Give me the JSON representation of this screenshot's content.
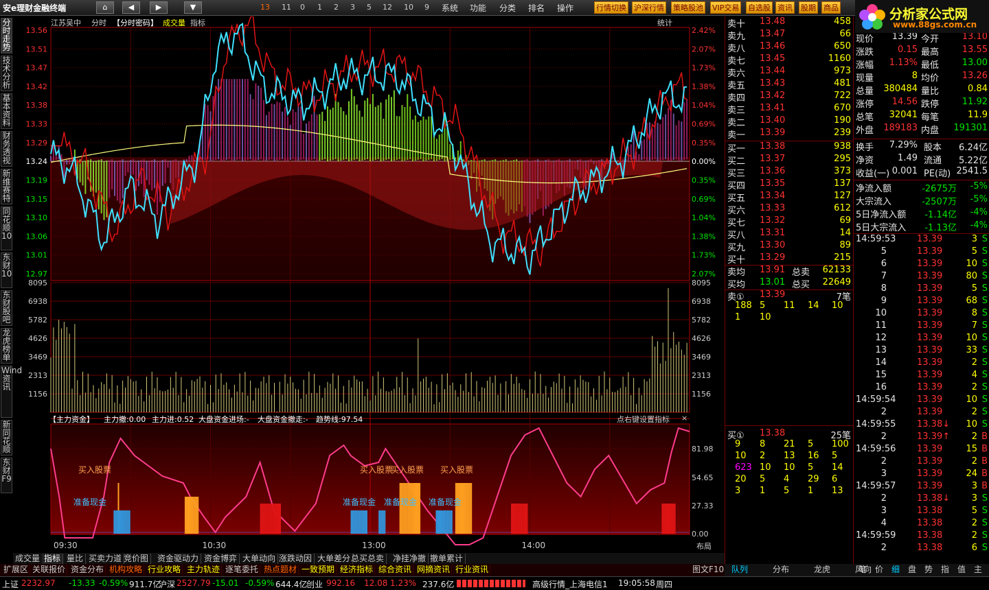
{
  "app": {
    "title": "安e理财金融终端",
    "numbers": [
      "13",
      "11",
      "0",
      "1",
      "2",
      "3",
      "5",
      "12",
      "10",
      "9"
    ],
    "menu": [
      "系统",
      "功能",
      "分类",
      "排名",
      "操作"
    ],
    "buttons": [
      "行情切换",
      "沪深行情",
      "策略股池",
      "VIP交易",
      "自选股",
      "资讯",
      "股期",
      "商品"
    ],
    "brand": "分析家公式网",
    "brand_url": "www.88gs.com.cn"
  },
  "left_tabs": [
    "分时走势",
    "技术分析",
    "基本资料",
    "财务透视",
    "新维赛特",
    "同花顺10",
    "东财10",
    "东财股吧",
    "龙虎榜单",
    "Wind资讯",
    "新同花顺",
    "东财F9"
  ],
  "chart": {
    "stock": "江苏吴中",
    "labels": [
      "分时",
      "【分时密码】",
      "成交量",
      "指标"
    ],
    "stats_label": "统计",
    "price_ticks": [
      "13.56",
      "13.51",
      "13.47",
      "13.42",
      "13.38",
      "13.33",
      "13.29",
      "13.24",
      "13.19",
      "13.15",
      "13.10",
      "13.06",
      "13.01",
      "12.97"
    ],
    "pct_ticks": [
      "2.42%",
      "2.07%",
      "1.73%",
      "1.38%",
      "1.04%",
      "0.69%",
      "0.35%",
      "0.00%",
      "0.35%",
      "0.69%",
      "1.04%",
      "1.38%",
      "1.73%",
      "2.07%"
    ],
    "vol_ticks": [
      "8095",
      "6938",
      "5782",
      "4626",
      "3469",
      "2313",
      "1156"
    ],
    "ind_header": [
      "【主力资金】",
      "主力撤:0.00",
      "主力进:0.52",
      "大盘资金进场:-",
      "大盘资金撤走:-",
      "趋势线:97.54"
    ],
    "ind_hint": "点右键设置指标",
    "ind_ticks": [
      "81.98",
      "54.65",
      "27.33",
      "0.00"
    ],
    "signals": [
      {
        "text": "买入股票",
        "kind": "buy"
      },
      {
        "text": "准备现金",
        "kind": "cash"
      },
      {
        "text": "准备现金",
        "kind": "cash"
      },
      {
        "text": "买入股票",
        "kind": "buy"
      },
      {
        "text": "买入股票",
        "kind": "buy"
      },
      {
        "text": "准备现金",
        "kind": "cash"
      },
      {
        "text": "准备现金",
        "kind": "cash"
      },
      {
        "text": "买入股票",
        "kind": "buy"
      }
    ],
    "time_ticks": [
      "09:30",
      "10:30",
      "13:00",
      "14:00"
    ],
    "layout_label": "布局",
    "close_label": "×"
  },
  "bottom_tabs": [
    "成交量",
    "指标",
    "量比",
    "买卖力道",
    "竞价图",
    "资金驱动力",
    "资金博弈",
    "大单动向",
    "涨跌动因",
    "大单差分",
    "总买总卖",
    "净挂净撤",
    "撤单累计"
  ],
  "tools": [
    "扩展区",
    "关联报价",
    "资金分布",
    "机构攻略",
    "行业攻略",
    "主力轨迹",
    "逐笔委托",
    "热点题材",
    "一致预期",
    "经济指标",
    "综合资讯",
    "网摘资讯",
    "行业资讯"
  ],
  "tools_right": "图文F10",
  "status": {
    "sh_label": "上证",
    "sh": "2232.97",
    "sh_chg": "-13.33",
    "sh_pct": "-0.59%",
    "sh_amt": "911.7亿",
    "sz_label": "沪深",
    "sz": "2527.79",
    "sz_chg": "-15.01",
    "sz_pct": "-0.59%",
    "sz_amt": "644.4亿",
    "cy_label": "创业",
    "cy": "992.16",
    "cy_chg": "12.08",
    "cy_pct": "1.23%",
    "cy_amt": "237.6亿",
    "feed": "高级行情_上海电信1",
    "time": "19:05:58",
    "day": "周四"
  },
  "orderbook": {
    "asks": [
      [
        "卖十",
        "13.48",
        "458"
      ],
      [
        "卖九",
        "13.47",
        "66"
      ],
      [
        "卖八",
        "13.46",
        "650"
      ],
      [
        "卖七",
        "13.45",
        "1160"
      ],
      [
        "卖六",
        "13.44",
        "973"
      ],
      [
        "卖五",
        "13.43",
        "481"
      ],
      [
        "卖四",
        "13.42",
        "722"
      ],
      [
        "卖三",
        "13.41",
        "670"
      ],
      [
        "卖二",
        "13.40",
        "190"
      ],
      [
        "卖一",
        "13.39",
        "239"
      ]
    ],
    "bids": [
      [
        "买一",
        "13.38",
        "938"
      ],
      [
        "买二",
        "13.37",
        "295"
      ],
      [
        "买三",
        "13.36",
        "373"
      ],
      [
        "买四",
        "13.35",
        "137"
      ],
      [
        "买五",
        "13.34",
        "127"
      ],
      [
        "买六",
        "13.33",
        "612"
      ],
      [
        "买七",
        "13.32",
        "69"
      ],
      [
        "买八",
        "13.31",
        "14"
      ],
      [
        "买九",
        "13.30",
        "89"
      ],
      [
        "买十",
        "13.29",
        "215"
      ]
    ],
    "avg": [
      [
        "卖均",
        "13.91",
        "总卖",
        "62133"
      ],
      [
        "买均",
        "13.01",
        "总买",
        "22649"
      ]
    ],
    "sell1": {
      "label": "卖①",
      "price": "13.39",
      "count": "7笔",
      "queue": [
        [
          "188",
          "5",
          "11",
          "14",
          "10"
        ],
        [
          "1",
          "10"
        ]
      ]
    },
    "buy1": {
      "label": "买①",
      "price": "13.38",
      "count": "25笔",
      "queue": [
        [
          "9",
          "8",
          "21",
          "5",
          "100"
        ],
        [
          "10",
          "2",
          "13",
          "16",
          "5"
        ],
        [
          "623",
          "10",
          "10",
          "5",
          "14"
        ],
        [
          "20",
          "5",
          "4",
          "29",
          "6"
        ],
        [
          "3",
          "1",
          "5",
          "1",
          "13"
        ]
      ]
    }
  },
  "info": {
    "top": [
      [
        "现价",
        "13.39",
        "今开",
        "13.10"
      ],
      [
        "涨跌",
        "0.15",
        "最高",
        "13.55"
      ],
      [
        "涨幅",
        "1.13%",
        "最低",
        "13.00"
      ],
      [
        "现量",
        "8",
        "均价",
        "13.26"
      ],
      [
        "总量",
        "380484",
        "量比",
        "0.84"
      ],
      [
        "涨停",
        "14.56",
        "跌停",
        "11.92"
      ],
      [
        "总笔",
        "32041",
        "每笔",
        "11.9"
      ],
      [
        "外盘",
        "189183",
        "内盘",
        "191301"
      ]
    ],
    "mid": [
      [
        "换手",
        "7.29%",
        "股本",
        "6.24亿"
      ],
      [
        "净资",
        "1.49",
        "流通",
        "5.22亿"
      ],
      [
        "收益(一)",
        "0.001",
        "PE(动)",
        "2541.5"
      ]
    ],
    "flows": [
      [
        "净流入额",
        "-2675万",
        "-5%"
      ],
      [
        "大宗流入",
        "-2507万",
        "-5%"
      ],
      [
        "5日净流入额",
        "-1.14亿",
        "-4%"
      ],
      [
        "5日大宗流入",
        "-1.13亿",
        "-4%"
      ]
    ],
    "ticks": [
      [
        "14:59:53",
        "13.39",
        "3",
        "S"
      ],
      [
        "5",
        "13.39",
        "5",
        "S"
      ],
      [
        "6",
        "13.39",
        "10",
        "S"
      ],
      [
        "7",
        "13.39",
        "80",
        "S"
      ],
      [
        "8",
        "13.39",
        "5",
        "S"
      ],
      [
        "9",
        "13.39",
        "68",
        "S"
      ],
      [
        "10",
        "13.39",
        "8",
        "S"
      ],
      [
        "11",
        "13.39",
        "7",
        "S"
      ],
      [
        "12",
        "13.39",
        "10",
        "S"
      ],
      [
        "13",
        "13.39",
        "33",
        "S"
      ],
      [
        "14",
        "13.39",
        "2",
        "S"
      ],
      [
        "15",
        "13.39",
        "4",
        "S"
      ],
      [
        "16",
        "13.39",
        "2",
        "S"
      ],
      [
        "14:59:54",
        "13.39",
        "10",
        "S"
      ],
      [
        "2",
        "13.39",
        "2",
        "S"
      ],
      [
        "14:59:55",
        "13.38↓",
        "10",
        "S"
      ],
      [
        "2",
        "13.39↑",
        "2",
        "B"
      ],
      [
        "14:59:56",
        "13.39",
        "15",
        "B"
      ],
      [
        "2",
        "13.39",
        "2",
        "B"
      ],
      [
        "3",
        "13.39",
        "24",
        "B"
      ],
      [
        "14:59:57",
        "13.39",
        "3",
        "B"
      ],
      [
        "2",
        "13.38↓",
        "3",
        "S"
      ],
      [
        "3",
        "13.38",
        "5",
        "S"
      ],
      [
        "4",
        "13.38",
        "2",
        "S"
      ],
      [
        "14:59:59",
        "13.38",
        "2",
        "S"
      ],
      [
        "2",
        "13.38",
        "6",
        "S"
      ]
    ]
  },
  "right_tabs": [
    "队列",
    "分布",
    "龙虎",
    "风向"
  ],
  "far_right_tabs": [
    "笔",
    "价",
    "细",
    "盘",
    "势",
    "指",
    "值",
    "主"
  ]
}
